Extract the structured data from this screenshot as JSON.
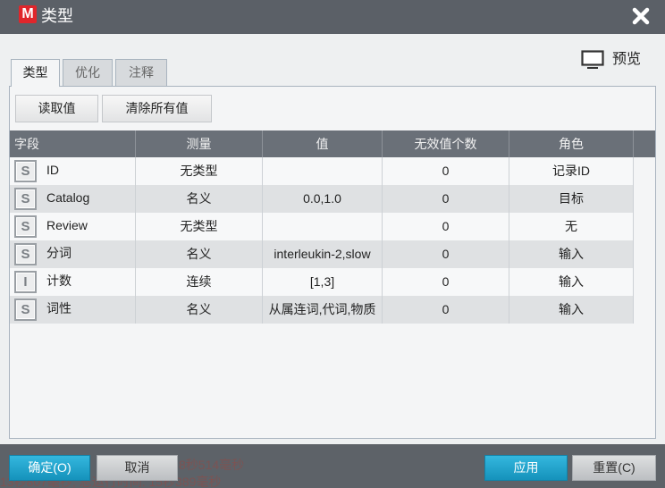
{
  "window": {
    "title": "类型",
    "logo_letter": "M"
  },
  "preview": {
    "label": "预览"
  },
  "tabs": [
    {
      "label": "类型",
      "active": true
    },
    {
      "label": "优化",
      "active": false
    },
    {
      "label": "注释",
      "active": false
    }
  ],
  "toolbar": {
    "read_values_label": "读取值",
    "clear_values_label": "清除所有值"
  },
  "table": {
    "columns": [
      "字段",
      "测量",
      "值",
      "无效值个数",
      "角色"
    ],
    "rows": [
      {
        "type_icon": "S",
        "field": "ID",
        "measure": "无类型",
        "value": "",
        "invalid_count": "0",
        "role": "记录ID"
      },
      {
        "type_icon": "S",
        "field": "Catalog",
        "measure": "名义",
        "value": "0.0,1.0",
        "invalid_count": "0",
        "role": "目标"
      },
      {
        "type_icon": "S",
        "field": "Review",
        "measure": "无类型",
        "value": "",
        "invalid_count": "0",
        "role": "无"
      },
      {
        "type_icon": "S",
        "field": "分词",
        "measure": "名义",
        "value": "interleukin-2,slow",
        "invalid_count": "0",
        "role": "输入"
      },
      {
        "type_icon": "I",
        "field": "计数",
        "measure": "连续",
        "value": "[1,3]",
        "invalid_count": "0",
        "role": "输入"
      },
      {
        "type_icon": "S",
        "field": "词性",
        "measure": "名义",
        "value": "从属连词,代词,物质",
        "invalid_count": "0",
        "role": "输入"
      }
    ]
  },
  "footer": {
    "ok_label": "确定(O)",
    "cancel_label": "取消",
    "apply_label": "应用",
    "reset_label": "重置(C)"
  },
  "background_log": {
    "line1": "8秒514毫秒",
    "line2": "13秒807毫秒; 总运行时间: 15秒389毫秒"
  },
  "icons": {
    "logo": "app-logo-icon",
    "close": "close-icon",
    "preview": "monitor-icon",
    "string_type": "string-type-icon",
    "integer_type": "integer-type-icon"
  },
  "colors": {
    "title_bar": "#5b6067",
    "accent": "#1ea5cf",
    "logo_red": "#e0262b",
    "header_bg": "#6a7078",
    "row_alt": "#dfe1e3"
  }
}
